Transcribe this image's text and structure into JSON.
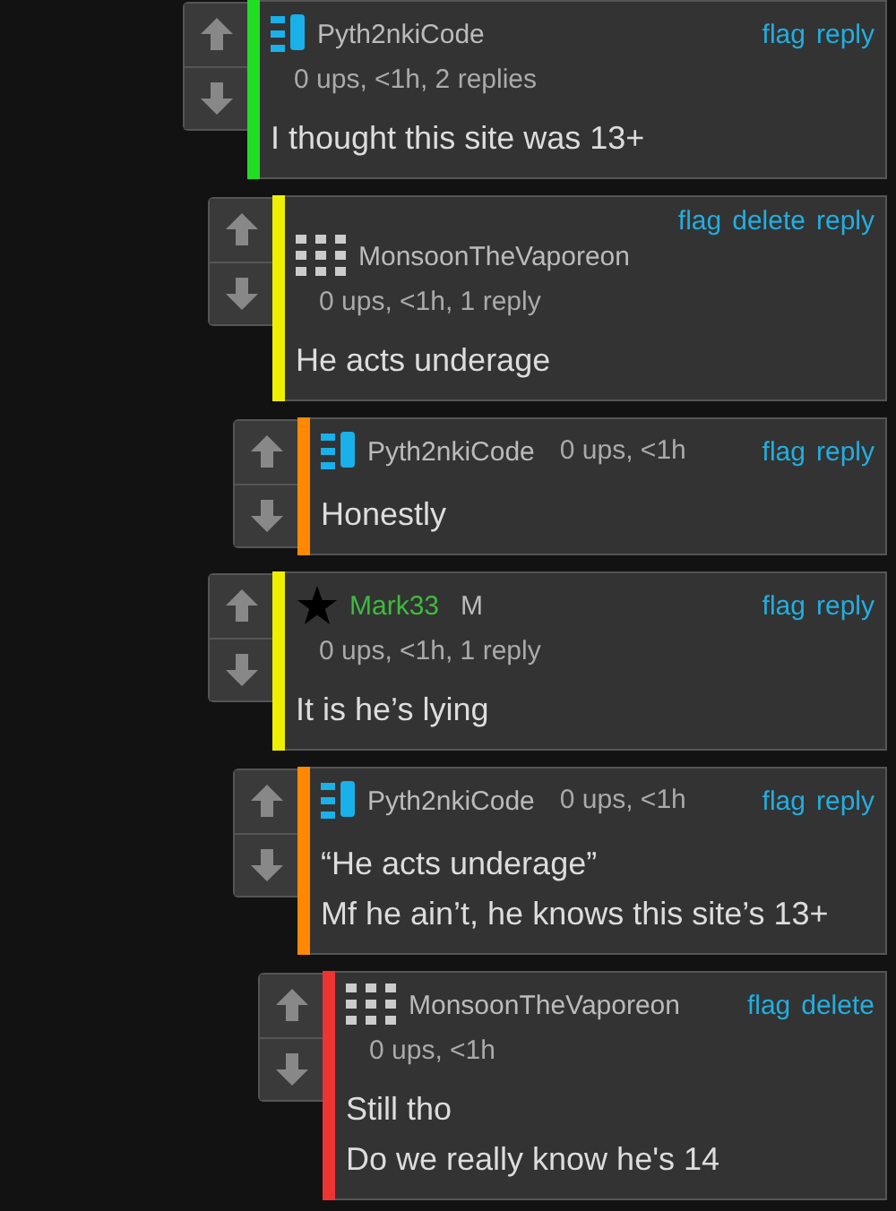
{
  "comments": [
    {
      "color": "#22dd22",
      "kind": "blocks",
      "username": "Pyth2nkiCode",
      "highlighted": false,
      "meta": "0 ups, <1h, 2 replies",
      "meta_inline": false,
      "actions_above": false,
      "actions": [
        "flag",
        "reply"
      ],
      "text": "I thought this site was 13+",
      "children": [
        {
          "color": "#eeee00",
          "kind": "dots",
          "username": "MonsoonTheVaporeon",
          "highlighted": false,
          "meta": "0 ups, <1h, 1 reply",
          "meta_inline": false,
          "actions_above": true,
          "actions": [
            "flag",
            "delete",
            "reply"
          ],
          "text": "He acts underage",
          "children": [
            {
              "color": "#ff8800",
              "kind": "blocks",
              "username": "Pyth2nkiCode",
              "highlighted": false,
              "meta": "0 ups, <1h",
              "meta_inline": true,
              "actions_above": false,
              "actions": [
                "flag",
                "reply"
              ],
              "text": "Honestly"
            }
          ]
        },
        {
          "color": "#eeee00",
          "kind": "star",
          "username": "Mark33",
          "highlighted": true,
          "badge": "M",
          "meta": "0 ups, <1h, 1 reply",
          "meta_inline": false,
          "actions_above": false,
          "actions": [
            "flag",
            "reply"
          ],
          "text": "It is he’s lying",
          "children": [
            {
              "color": "#ff8800",
              "kind": "blocks",
              "username": "Pyth2nkiCode",
              "highlighted": false,
              "meta": "0 ups, <1h",
              "meta_inline": true,
              "actions_above": false,
              "actions": [
                "flag",
                "reply"
              ],
              "text": "“He acts underage”\nMf he ain’t, he knows this site’s 13+",
              "children": [
                {
                  "color": "#ee3333",
                  "kind": "dots",
                  "username": "MonsoonTheVaporeon",
                  "highlighted": false,
                  "meta": "0 ups, <1h",
                  "meta_inline": false,
                  "actions_above": false,
                  "actions": [
                    "flag",
                    "delete"
                  ],
                  "text": "Still tho\nDo we really know he's 14"
                }
              ]
            }
          ]
        }
      ]
    }
  ]
}
